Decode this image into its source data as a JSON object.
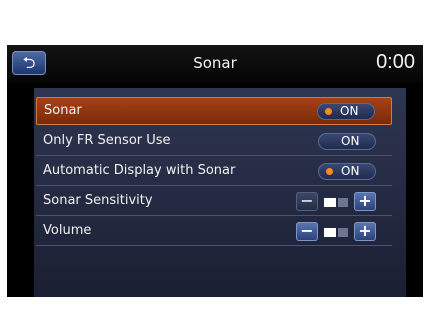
{
  "header": {
    "back_icon": "back-arrow-icon",
    "title": "Sonar",
    "clock": "0:00"
  },
  "settings": [
    {
      "label": "Sonar",
      "control": "toggle",
      "state": "ON",
      "indicator": true,
      "selected": true
    },
    {
      "label": "Only FR Sensor Use",
      "control": "toggle",
      "state": "ON",
      "indicator": false,
      "selected": false
    },
    {
      "label": "Automatic Display with Sonar",
      "control": "toggle",
      "state": "ON",
      "indicator": true,
      "selected": false
    },
    {
      "label": "Sonar Sensitivity",
      "control": "stepper",
      "minus": "−",
      "plus": "+",
      "level": 0.5
    },
    {
      "label": "Volume",
      "control": "stepper",
      "minus": "−",
      "plus": "+",
      "level": 0.5
    }
  ],
  "colors": {
    "accent_selected": "#a44216",
    "indicator": "#ff8a1e",
    "panel": "#2f3651"
  }
}
